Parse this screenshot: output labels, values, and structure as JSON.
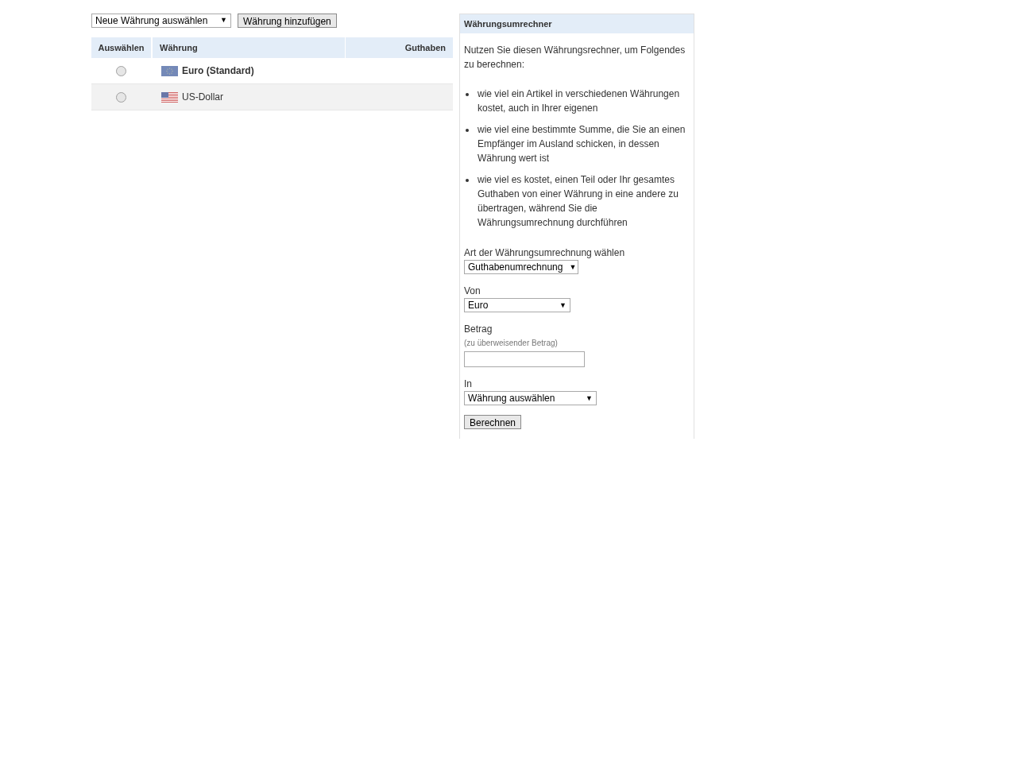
{
  "toolbar": {
    "currency_select": {
      "value": "Neue Währung auswählen",
      "arrow": "▼"
    },
    "add_button": "Währung hinzufügen"
  },
  "table": {
    "columns": [
      "Auswählen",
      "Währung",
      "Guthaben"
    ],
    "rows": [
      {
        "currency": "Euro (Standard)",
        "kind": "eu",
        "default": true,
        "selected": false
      },
      {
        "currency": "US-Dollar",
        "kind": "us",
        "default": false,
        "selected": false
      }
    ]
  },
  "converter": {
    "title": "Währungsumrechner",
    "intro": "Nutzen Sie diesen Währungsrechner, um Folgendes zu berechnen:",
    "bullets": [
      "wie viel ein Artikel in verschiedenen Währungen kostet, auch in Ihrer eigenen",
      "wie viel eine bestimmte Summe, die Sie an einen Empfänger im Ausland schicken, in dessen Währung wert ist",
      "wie viel es kostet, einen Teil oder Ihr gesamtes Guthaben von einer Währung in eine andere zu übertragen, während Sie die Währungsumrechnung durchführen"
    ],
    "type_label": "Art der Währungsumrechnung wählen",
    "type_select": {
      "value": "Guthabenumrechnung",
      "arrow": "▼"
    },
    "from_label": "Von",
    "from_select": {
      "value": "Euro",
      "arrow": "▼"
    },
    "amount_label": "Betrag",
    "amount_hint": "(zu überweisender Betrag)",
    "to_label": "In",
    "to_select": {
      "value": "Währung auswählen",
      "arrow": "▼"
    },
    "calculate_button": "Berechnen"
  }
}
